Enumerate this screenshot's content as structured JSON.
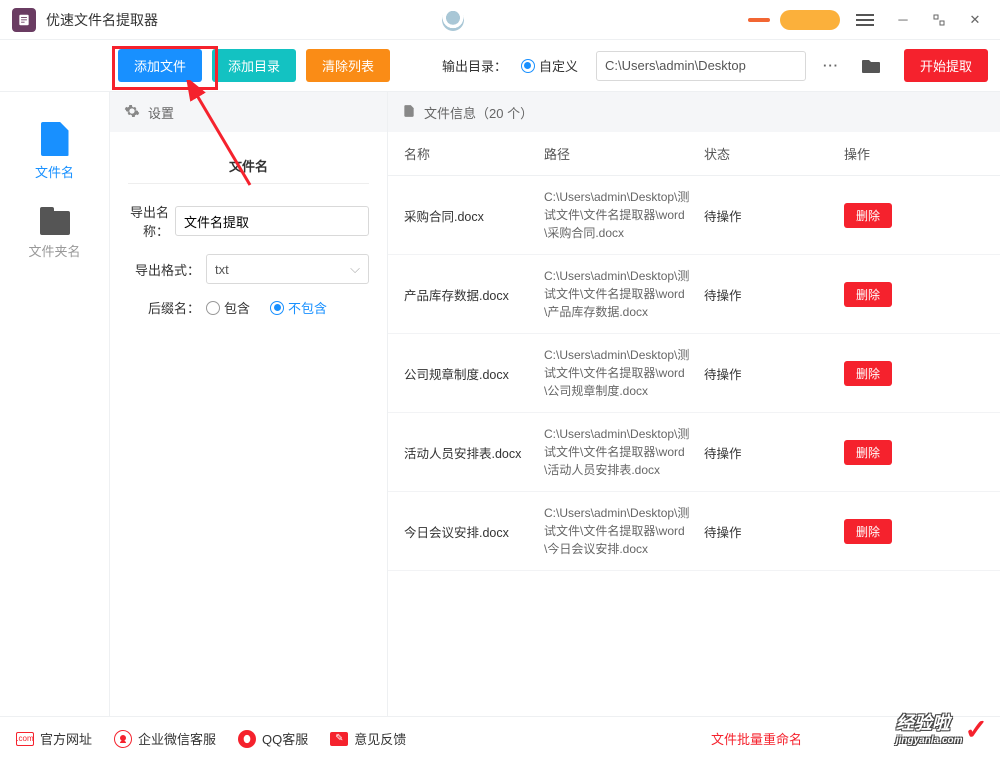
{
  "app": {
    "title": "优速文件名提取器"
  },
  "toolbar": {
    "add_file": "添加文件",
    "add_dir": "添加目录",
    "clear_list": "清除列表",
    "out_dir_label": "输出目录：",
    "custom_label": "自定义",
    "path_value": "C:\\Users\\admin\\Desktop",
    "start_extract": "开始提取"
  },
  "sidebar": {
    "items": [
      {
        "label": "文件名"
      },
      {
        "label": "文件夹名"
      }
    ]
  },
  "settings": {
    "panel_title": "设置",
    "section_title": "文件名",
    "export_name_label": "导出名称：",
    "export_name_value": "文件名提取",
    "export_format_label": "导出格式：",
    "export_format_value": "txt",
    "suffix_label": "后缀名：",
    "suffix_include": "包含",
    "suffix_exclude": "不包含"
  },
  "file_info": {
    "header": "文件信息（20 个）",
    "columns": {
      "name": "名称",
      "path": "路径",
      "status": "状态",
      "action": "操作"
    },
    "delete_label": "删除",
    "status_pending": "待操作",
    "rows": [
      {
        "name": "采购合同.docx",
        "path": "C:\\Users\\admin\\Desktop\\测试文件\\文件名提取器\\word\\采购合同.docx"
      },
      {
        "name": "产品库存数据.docx",
        "path": "C:\\Users\\admin\\Desktop\\测试文件\\文件名提取器\\word\\产品库存数据.docx"
      },
      {
        "name": "公司规章制度.docx",
        "path": "C:\\Users\\admin\\Desktop\\测试文件\\文件名提取器\\word\\公司规章制度.docx"
      },
      {
        "name": "活动人员安排表.docx",
        "path": "C:\\Users\\admin\\Desktop\\测试文件\\文件名提取器\\word\\活动人员安排表.docx"
      },
      {
        "name": "今日会议安排.docx",
        "path": "C:\\Users\\admin\\Desktop\\测试文件\\文件名提取器\\word\\今日会议安排.docx"
      }
    ]
  },
  "footer": {
    "official_site": "官方网址",
    "wechat_support": "企业微信客服",
    "qq_support": "QQ客服",
    "feedback": "意见反馈",
    "batch_rename": "文件批量重命名"
  },
  "watermark": {
    "main": "经验啦",
    "sub": "jingyanla.com"
  }
}
